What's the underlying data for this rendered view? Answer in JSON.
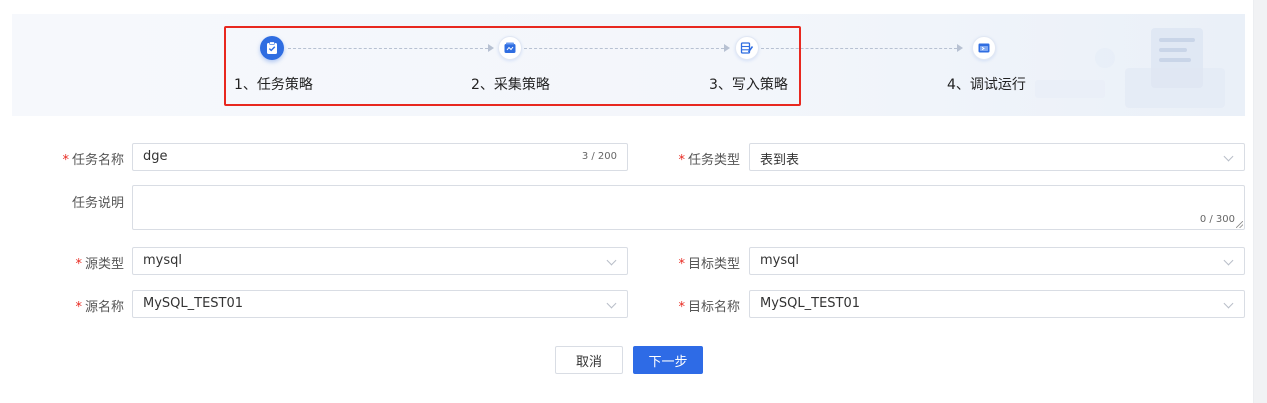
{
  "steps": [
    {
      "label": "1、任务策略",
      "icon": "clipboard-check-icon",
      "active": true
    },
    {
      "label": "2、采集策略",
      "icon": "collect-box-icon",
      "active": false
    },
    {
      "label": "3、写入策略",
      "icon": "write-table-icon",
      "active": false
    },
    {
      "label": "4、调试运行",
      "icon": "debug-run-icon",
      "active": false
    }
  ],
  "form": {
    "task_name": {
      "label": "任务名称",
      "value": "dge",
      "counter": "3 / 200",
      "required": true
    },
    "task_type": {
      "label": "任务类型",
      "value": "表到表",
      "required": true
    },
    "task_desc": {
      "label": "任务说明",
      "value": "",
      "counter": "0 / 300",
      "required": false
    },
    "source_type": {
      "label": "源类型",
      "value": "mysql",
      "required": true
    },
    "target_type": {
      "label": "目标类型",
      "value": "mysql",
      "required": true
    },
    "source_name": {
      "label": "源名称",
      "value": "MySQL_TEST01",
      "required": true
    },
    "target_name": {
      "label": "目标名称",
      "value": "MySQL_TEST01",
      "required": true
    }
  },
  "buttons": {
    "cancel": "取消",
    "next": "下一步"
  },
  "colors": {
    "primary": "#2e6be6",
    "required": "#e8281f",
    "highlight_border": "#e8281f"
  }
}
